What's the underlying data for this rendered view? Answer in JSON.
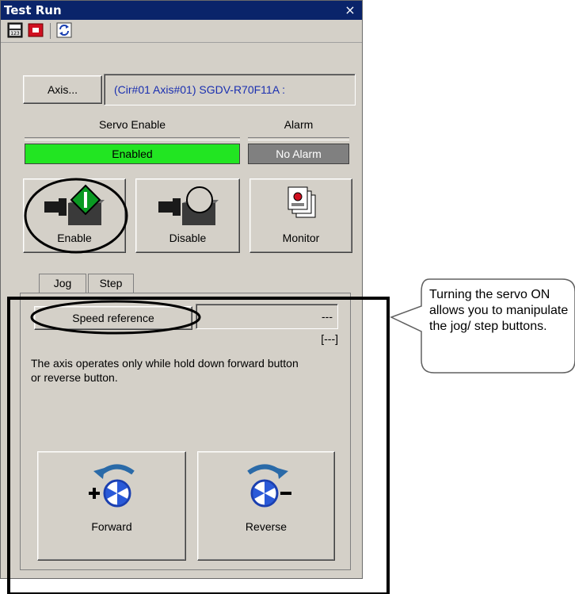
{
  "window": {
    "title": "Test Run",
    "close_label": "×"
  },
  "toolbar": {
    "icons": [
      "calculator-123-icon",
      "record-red-icon",
      "refresh-icon"
    ]
  },
  "axis": {
    "button_label": "Axis...",
    "value": "(Cir#01 Axis#01) SGDV-R70F11A :"
  },
  "servo": {
    "enable_heading": "Servo Enable",
    "alarm_heading": "Alarm",
    "enable_status": "Enabled",
    "alarm_status": "No Alarm",
    "enabled_color": "#22e522",
    "buttons": {
      "enable": "Enable",
      "disable": "Disable",
      "monitor": "Monitor"
    }
  },
  "tabs": {
    "items": [
      "Jog",
      "Step"
    ],
    "active": "Jog"
  },
  "jog": {
    "speed_button": "Speed reference",
    "speed_value": "---",
    "speed_unit": "[---]",
    "description": "The axis operates only while hold down forward button or reverse button.",
    "forward_label": "Forward",
    "reverse_label": "Reverse"
  },
  "callout": {
    "text": "Turning the servo ON allows you to manipulate the jog/ step buttons."
  }
}
